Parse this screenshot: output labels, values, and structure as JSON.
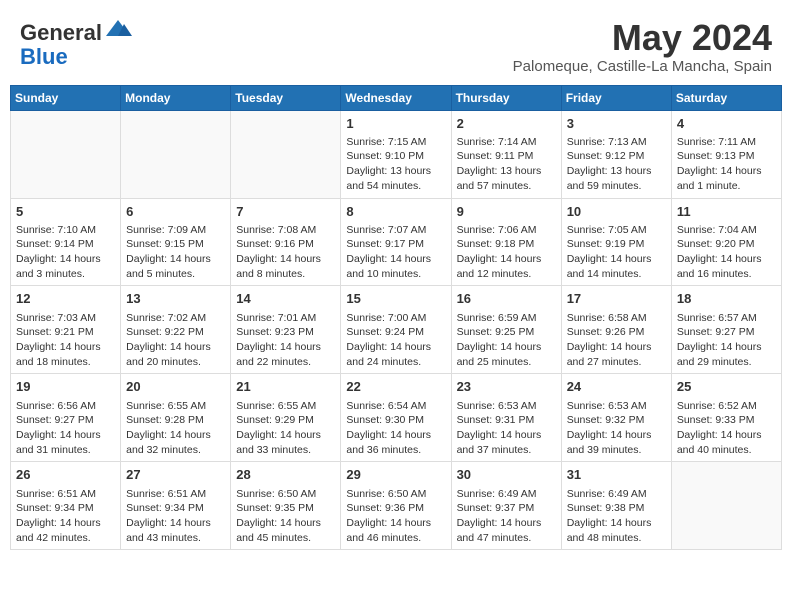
{
  "header": {
    "logo_line1": "General",
    "logo_line2": "Blue",
    "month": "May 2024",
    "location": "Palomeque, Castille-La Mancha, Spain"
  },
  "weekdays": [
    "Sunday",
    "Monday",
    "Tuesday",
    "Wednesday",
    "Thursday",
    "Friday",
    "Saturday"
  ],
  "weeks": [
    [
      {
        "day": "",
        "info": ""
      },
      {
        "day": "",
        "info": ""
      },
      {
        "day": "",
        "info": ""
      },
      {
        "day": "1",
        "info": "Sunrise: 7:15 AM\nSunset: 9:10 PM\nDaylight: 13 hours\nand 54 minutes."
      },
      {
        "day": "2",
        "info": "Sunrise: 7:14 AM\nSunset: 9:11 PM\nDaylight: 13 hours\nand 57 minutes."
      },
      {
        "day": "3",
        "info": "Sunrise: 7:13 AM\nSunset: 9:12 PM\nDaylight: 13 hours\nand 59 minutes."
      },
      {
        "day": "4",
        "info": "Sunrise: 7:11 AM\nSunset: 9:13 PM\nDaylight: 14 hours\nand 1 minute."
      }
    ],
    [
      {
        "day": "5",
        "info": "Sunrise: 7:10 AM\nSunset: 9:14 PM\nDaylight: 14 hours\nand 3 minutes."
      },
      {
        "day": "6",
        "info": "Sunrise: 7:09 AM\nSunset: 9:15 PM\nDaylight: 14 hours\nand 5 minutes."
      },
      {
        "day": "7",
        "info": "Sunrise: 7:08 AM\nSunset: 9:16 PM\nDaylight: 14 hours\nand 8 minutes."
      },
      {
        "day": "8",
        "info": "Sunrise: 7:07 AM\nSunset: 9:17 PM\nDaylight: 14 hours\nand 10 minutes."
      },
      {
        "day": "9",
        "info": "Sunrise: 7:06 AM\nSunset: 9:18 PM\nDaylight: 14 hours\nand 12 minutes."
      },
      {
        "day": "10",
        "info": "Sunrise: 7:05 AM\nSunset: 9:19 PM\nDaylight: 14 hours\nand 14 minutes."
      },
      {
        "day": "11",
        "info": "Sunrise: 7:04 AM\nSunset: 9:20 PM\nDaylight: 14 hours\nand 16 minutes."
      }
    ],
    [
      {
        "day": "12",
        "info": "Sunrise: 7:03 AM\nSunset: 9:21 PM\nDaylight: 14 hours\nand 18 minutes."
      },
      {
        "day": "13",
        "info": "Sunrise: 7:02 AM\nSunset: 9:22 PM\nDaylight: 14 hours\nand 20 minutes."
      },
      {
        "day": "14",
        "info": "Sunrise: 7:01 AM\nSunset: 9:23 PM\nDaylight: 14 hours\nand 22 minutes."
      },
      {
        "day": "15",
        "info": "Sunrise: 7:00 AM\nSunset: 9:24 PM\nDaylight: 14 hours\nand 24 minutes."
      },
      {
        "day": "16",
        "info": "Sunrise: 6:59 AM\nSunset: 9:25 PM\nDaylight: 14 hours\nand 25 minutes."
      },
      {
        "day": "17",
        "info": "Sunrise: 6:58 AM\nSunset: 9:26 PM\nDaylight: 14 hours\nand 27 minutes."
      },
      {
        "day": "18",
        "info": "Sunrise: 6:57 AM\nSunset: 9:27 PM\nDaylight: 14 hours\nand 29 minutes."
      }
    ],
    [
      {
        "day": "19",
        "info": "Sunrise: 6:56 AM\nSunset: 9:27 PM\nDaylight: 14 hours\nand 31 minutes."
      },
      {
        "day": "20",
        "info": "Sunrise: 6:55 AM\nSunset: 9:28 PM\nDaylight: 14 hours\nand 32 minutes."
      },
      {
        "day": "21",
        "info": "Sunrise: 6:55 AM\nSunset: 9:29 PM\nDaylight: 14 hours\nand 33 minutes."
      },
      {
        "day": "22",
        "info": "Sunrise: 6:54 AM\nSunset: 9:30 PM\nDaylight: 14 hours\nand 36 minutes."
      },
      {
        "day": "23",
        "info": "Sunrise: 6:53 AM\nSunset: 9:31 PM\nDaylight: 14 hours\nand 37 minutes."
      },
      {
        "day": "24",
        "info": "Sunrise: 6:53 AM\nSunset: 9:32 PM\nDaylight: 14 hours\nand 39 minutes."
      },
      {
        "day": "25",
        "info": "Sunrise: 6:52 AM\nSunset: 9:33 PM\nDaylight: 14 hours\nand 40 minutes."
      }
    ],
    [
      {
        "day": "26",
        "info": "Sunrise: 6:51 AM\nSunset: 9:34 PM\nDaylight: 14 hours\nand 42 minutes."
      },
      {
        "day": "27",
        "info": "Sunrise: 6:51 AM\nSunset: 9:34 PM\nDaylight: 14 hours\nand 43 minutes."
      },
      {
        "day": "28",
        "info": "Sunrise: 6:50 AM\nSunset: 9:35 PM\nDaylight: 14 hours\nand 45 minutes."
      },
      {
        "day": "29",
        "info": "Sunrise: 6:50 AM\nSunset: 9:36 PM\nDaylight: 14 hours\nand 46 minutes."
      },
      {
        "day": "30",
        "info": "Sunrise: 6:49 AM\nSunset: 9:37 PM\nDaylight: 14 hours\nand 47 minutes."
      },
      {
        "day": "31",
        "info": "Sunrise: 6:49 AM\nSunset: 9:38 PM\nDaylight: 14 hours\nand 48 minutes."
      },
      {
        "day": "",
        "info": ""
      }
    ]
  ]
}
